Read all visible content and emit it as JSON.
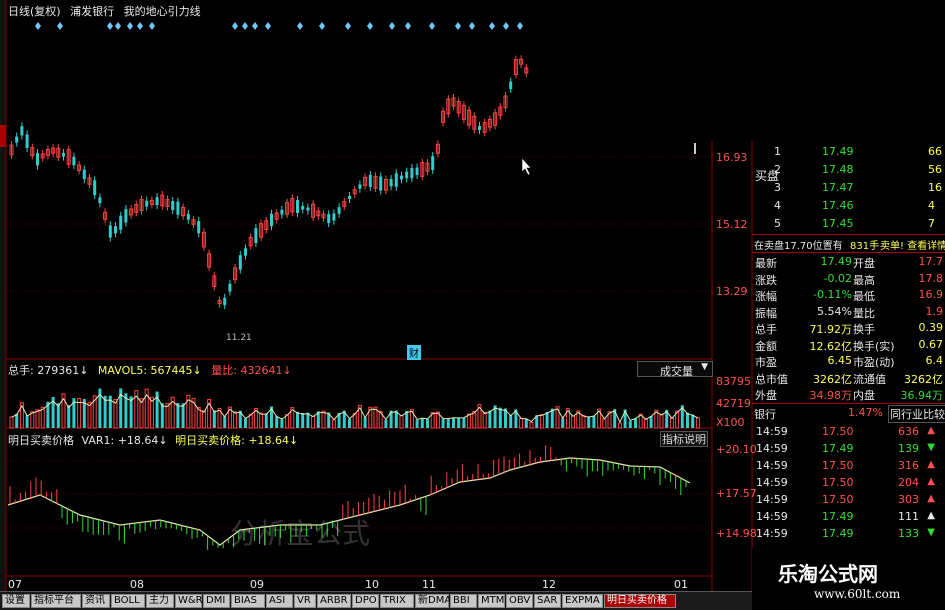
{
  "header": {
    "period": "日线(复权)",
    "stock_name": "浦发银行",
    "indicator": "我的地心引力线"
  },
  "price_axis": [
    "16.93",
    "15.12",
    "13.29"
  ],
  "markers": {
    "low_price": "11.21",
    "finance_badge": "财"
  },
  "volume": {
    "total_label": "总手: 279361",
    "mavol_label": "MAVOL5: 567445",
    "ratio_label": "量比: 432641",
    "dropdown": "成交量",
    "axis": [
      "83795",
      "42719",
      "X100"
    ]
  },
  "indicator_panel": {
    "title": "明日买卖价格",
    "var_label": "VAR1: +18.64",
    "price_label": "明日买卖价格: +18.64",
    "help_button": "指标说明",
    "axis": [
      "+20.10",
      "+17.57",
      "+14.98"
    ],
    "watermark": "分析宝公式"
  },
  "date_axis": [
    "07",
    "08",
    "09",
    "10",
    "11",
    "12",
    "01"
  ],
  "order_book": {
    "buy_label": "买盘",
    "rows": [
      {
        "level": "1",
        "price": "17.49",
        "vol": "66"
      },
      {
        "level": "2",
        "price": "17.48",
        "vol": "56"
      },
      {
        "level": "3",
        "price": "17.47",
        "vol": "16"
      },
      {
        "level": "4",
        "price": "17.46",
        "vol": "4"
      },
      {
        "level": "5",
        "price": "17.45",
        "vol": "7"
      }
    ],
    "notice": "在卖盘17.70位置有",
    "notice_count": "831手",
    "notice_tail": "卖单! 查看详情"
  },
  "quote": [
    {
      "k1": "最新",
      "v1": "17.49",
      "k2": "开盘",
      "v2": "17.7"
    },
    {
      "k1": "涨跌",
      "v1": "-0.02",
      "k2": "最高",
      "v2": "17.8"
    },
    {
      "k1": "涨幅",
      "v1": "-0.11%",
      "k2": "最低",
      "v2": "16.9"
    },
    {
      "k1": "振幅",
      "v1": "5.54%",
      "k2": "量比",
      "v2": "1.9"
    },
    {
      "k1": "总手",
      "v1": "71.92万",
      "k2": "换手",
      "v2": "0.39"
    },
    {
      "k1": "金额",
      "v1": "12.62亿",
      "k2": "换手(实)",
      "v2": "0.67"
    },
    {
      "k1": "市盈",
      "v1": "6.45",
      "k2": "市盈(动)",
      "v2": "6.4"
    },
    {
      "k1": "总市值",
      "v1": "3262亿",
      "k2": "流通值",
      "v2": "3262亿"
    },
    {
      "k1": "外盘",
      "v1": "34.98万",
      "k2": "内盘",
      "v2": "36.94万"
    }
  ],
  "sector": {
    "name": "银行",
    "change": "1.47%",
    "button": "同行业比较"
  },
  "ticks": [
    {
      "time": "14:59",
      "price": "17.50",
      "vol": "636",
      "dir": "up"
    },
    {
      "time": "14:59",
      "price": "17.49",
      "vol": "139",
      "dir": "down"
    },
    {
      "time": "14:59",
      "price": "17.50",
      "vol": "316",
      "dir": "up"
    },
    {
      "time": "14:59",
      "price": "17.50",
      "vol": "204",
      "dir": "up"
    },
    {
      "time": "14:59",
      "price": "17.50",
      "vol": "303",
      "dir": "up"
    },
    {
      "time": "14:59",
      "price": "17.49",
      "vol": "111",
      "dir": "flat"
    },
    {
      "time": "14:59",
      "price": "17.49",
      "vol": "133",
      "dir": "down"
    }
  ],
  "tabs": [
    "设置",
    "指标平台",
    "资讯",
    "BOLL",
    "主力",
    "W&R",
    "DMI",
    "BIAS",
    "ASI",
    "VR",
    "ARBR",
    "DPO",
    "TRIX",
    "新DMA",
    "BBI",
    "MTM",
    "OBV",
    "SAR",
    "EXPMA",
    "明日买卖价格"
  ],
  "brand": {
    "name": "乐淘公式网",
    "url": "www.60lt.com"
  },
  "colors": {
    "up": "#ff4444",
    "down": "#33cccc",
    "line": "#e8e8b0",
    "grid": "#7a0000",
    "accent": "#ffff55"
  }
}
